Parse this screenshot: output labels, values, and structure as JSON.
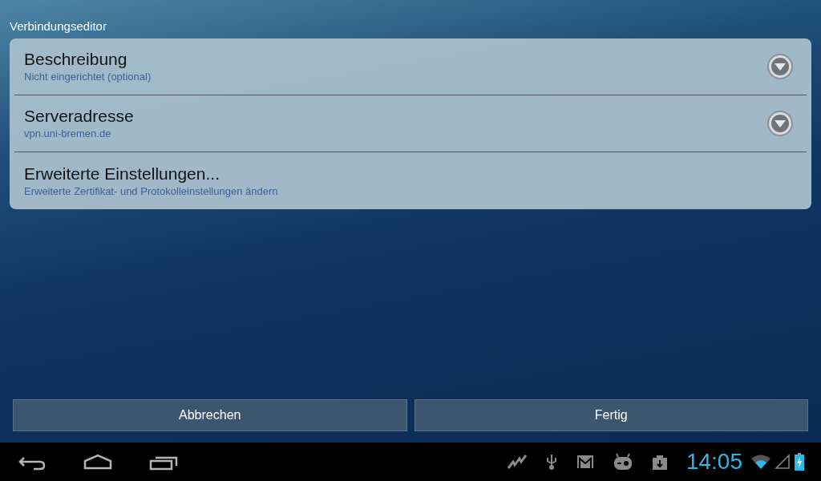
{
  "window": {
    "title": "Verbindungseditor"
  },
  "settings": [
    {
      "kind": "expandable",
      "title": "Beschreibung",
      "summary": "Nicht eingerichtet (optional)"
    },
    {
      "kind": "expandable",
      "title": "Serveradresse",
      "summary": "vpn.uni-bremen.de"
    },
    {
      "kind": "link",
      "title": "Erweiterte Einstellungen...",
      "summary": "Erweiterte Zertifikat- und Protokolleinstellungen ändern"
    }
  ],
  "buttons": [
    "Abbrechen",
    "Fertig"
  ],
  "status_bar": {
    "time": "14:05"
  }
}
